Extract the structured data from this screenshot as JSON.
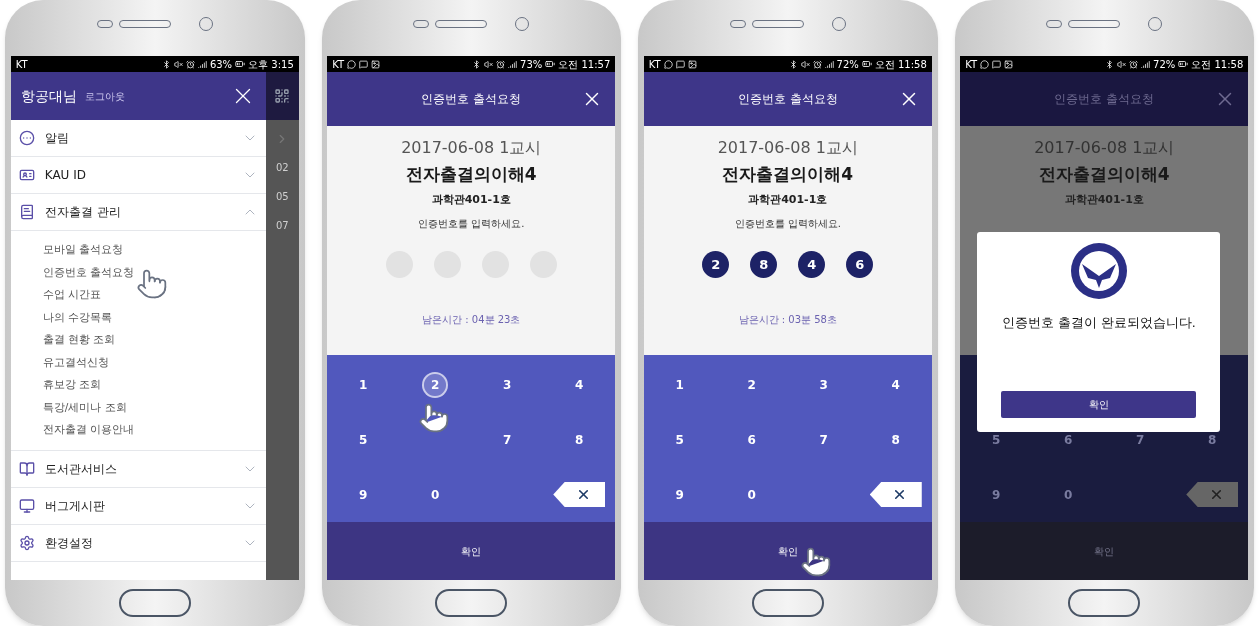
{
  "phones": [
    {
      "kind": "menu",
      "status_bar": {
        "carrier": "KT",
        "notifications": false,
        "battery": "63%",
        "time": "오후 3:15"
      },
      "drawer": {
        "user": "항공대님",
        "logout": "로그아웃",
        "items": [
          {
            "label": "알림",
            "expanded": false
          },
          {
            "label": "KAU ID",
            "expanded": false
          },
          {
            "label": "전자출결 관리",
            "expanded": true,
            "children": [
              {
                "label": "모바일 출석요청",
                "touched": false
              },
              {
                "label": "인증번호 출석요청",
                "touched": true
              },
              {
                "label": "수업 시간표",
                "touched": false
              },
              {
                "label": "나의 수강목록",
                "touched": false
              },
              {
                "label": "출결 현황 조회",
                "touched": false
              },
              {
                "label": "유고결석신청",
                "touched": false
              },
              {
                "label": "휴보강 조회",
                "touched": false
              },
              {
                "label": "특강/세미나 조회",
                "touched": false
              },
              {
                "label": "전자출결 이용안내",
                "touched": false
              }
            ]
          },
          {
            "label": "도서관서비스",
            "expanded": false
          },
          {
            "label": "버그게시판",
            "expanded": false
          },
          {
            "label": "환경설정",
            "expanded": false
          }
        ]
      },
      "background_fragments": [
        "02",
        "05",
        "07"
      ]
    },
    {
      "kind": "code_entry",
      "status_bar": {
        "carrier": "KT",
        "notifications": true,
        "battery": "73%",
        "time": "오전 11:57"
      },
      "title": "인증번호 출석요청",
      "date": "2017-06-08 1교시",
      "subject": "전자출결의이해4",
      "room": "과학관401-1호",
      "prompt": "인증번호를 입력하세요.",
      "digits": [
        {
          "filled": false
        },
        {
          "filled": false
        },
        {
          "filled": false
        },
        {
          "filled": false
        }
      ],
      "remaining": "남은시간 : 04분 23초",
      "keypad": {
        "backspace": true,
        "rows": [
          [
            {
              "label": "1",
              "touched": false
            },
            {
              "label": "2",
              "touched": true
            },
            {
              "label": "3",
              "touched": false
            },
            {
              "label": "4",
              "touched": false
            }
          ],
          [
            {
              "label": "5",
              "touched": false
            },
            {
              "touched": false
            },
            {
              "label": "7",
              "touched": false
            },
            {
              "label": "8",
              "touched": false
            }
          ],
          [
            {
              "label": "9",
              "touched": false
            },
            {
              "label": "0",
              "touched": false
            }
          ]
        ]
      },
      "confirm": {
        "label": "확인",
        "touched": false
      }
    },
    {
      "kind": "code_entry",
      "status_bar": {
        "carrier": "KT",
        "notifications": true,
        "battery": "72%",
        "time": "오전 11:58"
      },
      "title": "인증번호 출석요청",
      "date": "2017-06-08 1교시",
      "subject": "전자출결의이해4",
      "room": "과학관401-1호",
      "prompt": "인증번호를 입력하세요.",
      "digits": [
        {
          "filled": true,
          "value": "2"
        },
        {
          "filled": true,
          "value": "8"
        },
        {
          "filled": true,
          "value": "4"
        },
        {
          "filled": true,
          "value": "6"
        }
      ],
      "remaining": "남은시간 : 03분 58초",
      "keypad": {
        "backspace": true,
        "rows": [
          [
            {
              "label": "1",
              "touched": false
            },
            {
              "label": "2",
              "touched": false
            },
            {
              "label": "3",
              "touched": false
            },
            {
              "label": "4",
              "touched": false
            }
          ],
          [
            {
              "label": "5",
              "touched": false
            },
            {
              "label": "6",
              "touched": false
            },
            {
              "label": "7",
              "touched": false
            },
            {
              "label": "8",
              "touched": false
            }
          ],
          [
            {
              "label": "9",
              "touched": false
            },
            {
              "label": "0",
              "touched": false
            }
          ]
        ]
      },
      "confirm": {
        "label": "확인",
        "touched": true
      }
    },
    {
      "kind": "code_entry",
      "status_bar": {
        "carrier": "KT",
        "notifications": true,
        "battery": "72%",
        "time": "오전 11:58"
      },
      "title": "인증번호 출석요청",
      "date": "2017-06-08 1교시",
      "subject": "전자출결의이해4",
      "room": "과학관401-1호",
      "keypad": {
        "backspace": true,
        "rows": [
          [
            {
              "label": "5",
              "touched": false
            },
            {
              "label": "6",
              "touched": false
            },
            {
              "label": "7",
              "touched": false
            },
            {
              "label": "8",
              "touched": false
            }
          ],
          [
            {
              "label": "9",
              "touched": false
            },
            {
              "label": "0",
              "touched": false
            }
          ]
        ]
      },
      "confirm": {
        "label": "확인",
        "touched": false
      },
      "dialog": {
        "message": "인증번호 출결이 완료되었습니다.",
        "button": "확인"
      }
    }
  ]
}
